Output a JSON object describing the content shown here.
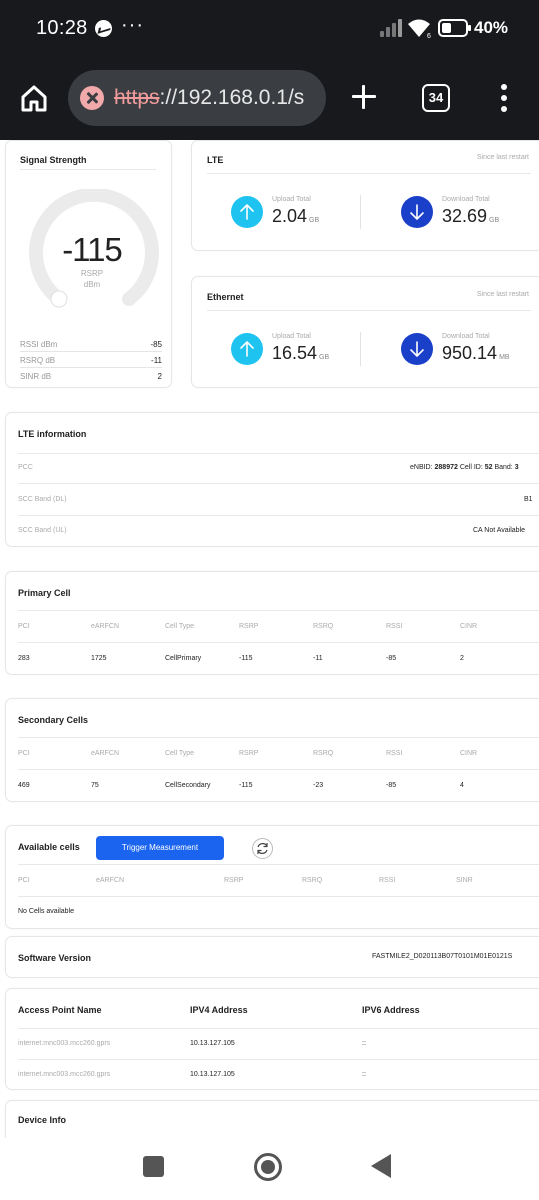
{
  "status_bar": {
    "time": "10:28",
    "more": "···",
    "battery_pct": "40%",
    "battery_level": 0.4
  },
  "browser": {
    "url_scheme": "https",
    "url_rest": "://192.168.0.1/s",
    "tab_count": "34"
  },
  "signal": {
    "title": "Signal Strength",
    "rsrp_value": "-115",
    "rsrp_label": "RSRP",
    "rsrp_unit": "dBm",
    "rows": [
      {
        "label": "RSSI dBm",
        "value": "-85"
      },
      {
        "label": "RSRQ dB",
        "value": "-11"
      },
      {
        "label": "SINR dB",
        "value": "2"
      }
    ]
  },
  "lte_traffic": {
    "title": "LTE",
    "since": "Since last restart",
    "upload_label": "Upload Total",
    "upload_value": "2.04",
    "upload_unit": "GB",
    "download_label": "Download Total",
    "download_value": "32.69",
    "download_unit": "GB"
  },
  "ethernet_traffic": {
    "title": "Ethernet",
    "since": "Since last restart",
    "upload_label": "Upload Total",
    "upload_value": "16.54",
    "upload_unit": "GB",
    "download_label": "Download Total",
    "download_value": "950.14",
    "download_unit": "MB"
  },
  "lte_info": {
    "title": "LTE information",
    "rows": [
      {
        "label": "PCC",
        "prefix1": "eNBID: ",
        "v1": "288972",
        "prefix2": " Cell ID: ",
        "v2": "52",
        "prefix3": " Band: ",
        "v3": "3"
      },
      {
        "label": "SCC Band (DL)",
        "value": "B1"
      },
      {
        "label": "SCC Band (UL)",
        "value": "CA Not Available"
      }
    ]
  },
  "primary_cell": {
    "title": "Primary Cell",
    "headers": [
      "PCI",
      "eARFCN",
      "Cell Type",
      "RSRP",
      "RSRQ",
      "RSSI",
      "CINR"
    ],
    "row": [
      "283",
      "1725",
      "CellPrimary",
      "-115",
      "-11",
      "-85",
      "2"
    ]
  },
  "secondary_cells": {
    "title": "Secondary Cells",
    "headers": [
      "PCI",
      "eARFCN",
      "Cell Type",
      "RSRP",
      "RSRQ",
      "RSSI",
      "CINR"
    ],
    "row": [
      "469",
      "75",
      "CellSecondary",
      "-115",
      "-23",
      "-85",
      "4"
    ]
  },
  "available_cells": {
    "title": "Available cells",
    "button": "Trigger Measurement",
    "headers": [
      "PCI",
      "eARFCN",
      "RSRP",
      "RSRQ",
      "RSSI",
      "SINR"
    ],
    "empty": "No Cells available"
  },
  "software": {
    "label": "Software Version",
    "value": "FASTMILE2_D020113B07T0101M01E0121S"
  },
  "apn": {
    "headers": [
      "Access Point Name",
      "IPV4 Address",
      "IPV6 Address"
    ],
    "rows": [
      [
        "internet.mnc003.mcc260.gprs",
        "10.13.127.105",
        "::"
      ],
      [
        "internet.mnc003.mcc260.gprs",
        "10.13.127.105",
        "::"
      ]
    ]
  },
  "device_info": {
    "title": "Device Info"
  },
  "colors": {
    "upload": "#1ec3f0",
    "download": "#1a3fc8",
    "button": "#1a64f0"
  },
  "icons": [
    "home-icon",
    "close-icon",
    "plus-icon",
    "tabs-icon",
    "more-vert-icon",
    "arrow-up-icon",
    "arrow-down-icon",
    "refresh-icon"
  ]
}
